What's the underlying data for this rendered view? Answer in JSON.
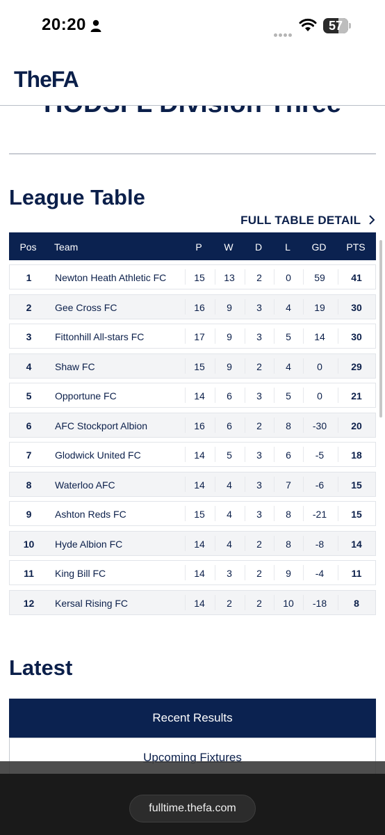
{
  "status_bar": {
    "time": "20:20",
    "battery": "57"
  },
  "header": {
    "logo": "TheFA"
  },
  "division_title": "HODSFL Division Three",
  "league_table": {
    "heading": "League Table",
    "full_table_link": "FULL TABLE DETAIL",
    "columns": {
      "pos": "Pos",
      "team": "Team",
      "p": "P",
      "w": "W",
      "d": "D",
      "l": "L",
      "gd": "GD",
      "pts": "PTS"
    },
    "rows": [
      {
        "pos": "1",
        "team": "Newton Heath Athletic FC",
        "p": "15",
        "w": "13",
        "d": "2",
        "l": "0",
        "gd": "59",
        "pts": "41"
      },
      {
        "pos": "2",
        "team": "Gee Cross FC",
        "p": "16",
        "w": "9",
        "d": "3",
        "l": "4",
        "gd": "19",
        "pts": "30"
      },
      {
        "pos": "3",
        "team": "Fittonhill All-stars FC",
        "p": "17",
        "w": "9",
        "d": "3",
        "l": "5",
        "gd": "14",
        "pts": "30"
      },
      {
        "pos": "4",
        "team": "Shaw FC",
        "p": "15",
        "w": "9",
        "d": "2",
        "l": "4",
        "gd": "0",
        "pts": "29"
      },
      {
        "pos": "5",
        "team": "Opportune FC",
        "p": "14",
        "w": "6",
        "d": "3",
        "l": "5",
        "gd": "0",
        "pts": "21"
      },
      {
        "pos": "6",
        "team": "AFC Stockport Albion",
        "p": "16",
        "w": "6",
        "d": "2",
        "l": "8",
        "gd": "-30",
        "pts": "20"
      },
      {
        "pos": "7",
        "team": "Glodwick United FC",
        "p": "14",
        "w": "5",
        "d": "3",
        "l": "6",
        "gd": "-5",
        "pts": "18"
      },
      {
        "pos": "8",
        "team": "Waterloo AFC",
        "p": "14",
        "w": "4",
        "d": "3",
        "l": "7",
        "gd": "-6",
        "pts": "15"
      },
      {
        "pos": "9",
        "team": "Ashton Reds FC",
        "p": "15",
        "w": "4",
        "d": "3",
        "l": "8",
        "gd": "-21",
        "pts": "15"
      },
      {
        "pos": "10",
        "team": "Hyde Albion FC",
        "p": "14",
        "w": "4",
        "d": "2",
        "l": "8",
        "gd": "-8",
        "pts": "14"
      },
      {
        "pos": "11",
        "team": "King Bill FC",
        "p": "14",
        "w": "3",
        "d": "2",
        "l": "9",
        "gd": "-4",
        "pts": "11"
      },
      {
        "pos": "12",
        "team": "Kersal Rising FC",
        "p": "14",
        "w": "2",
        "d": "2",
        "l": "10",
        "gd": "-18",
        "pts": "8"
      }
    ]
  },
  "latest": {
    "heading": "Latest",
    "tabs": {
      "recent": "Recent Results",
      "upcoming": "Upcoming Fixtures"
    }
  },
  "browser": {
    "url": "fulltime.thefa.com"
  },
  "colors": {
    "navy": "#0b2250",
    "text": "#0b1f4a",
    "row_alt": "#f3f4f6"
  }
}
